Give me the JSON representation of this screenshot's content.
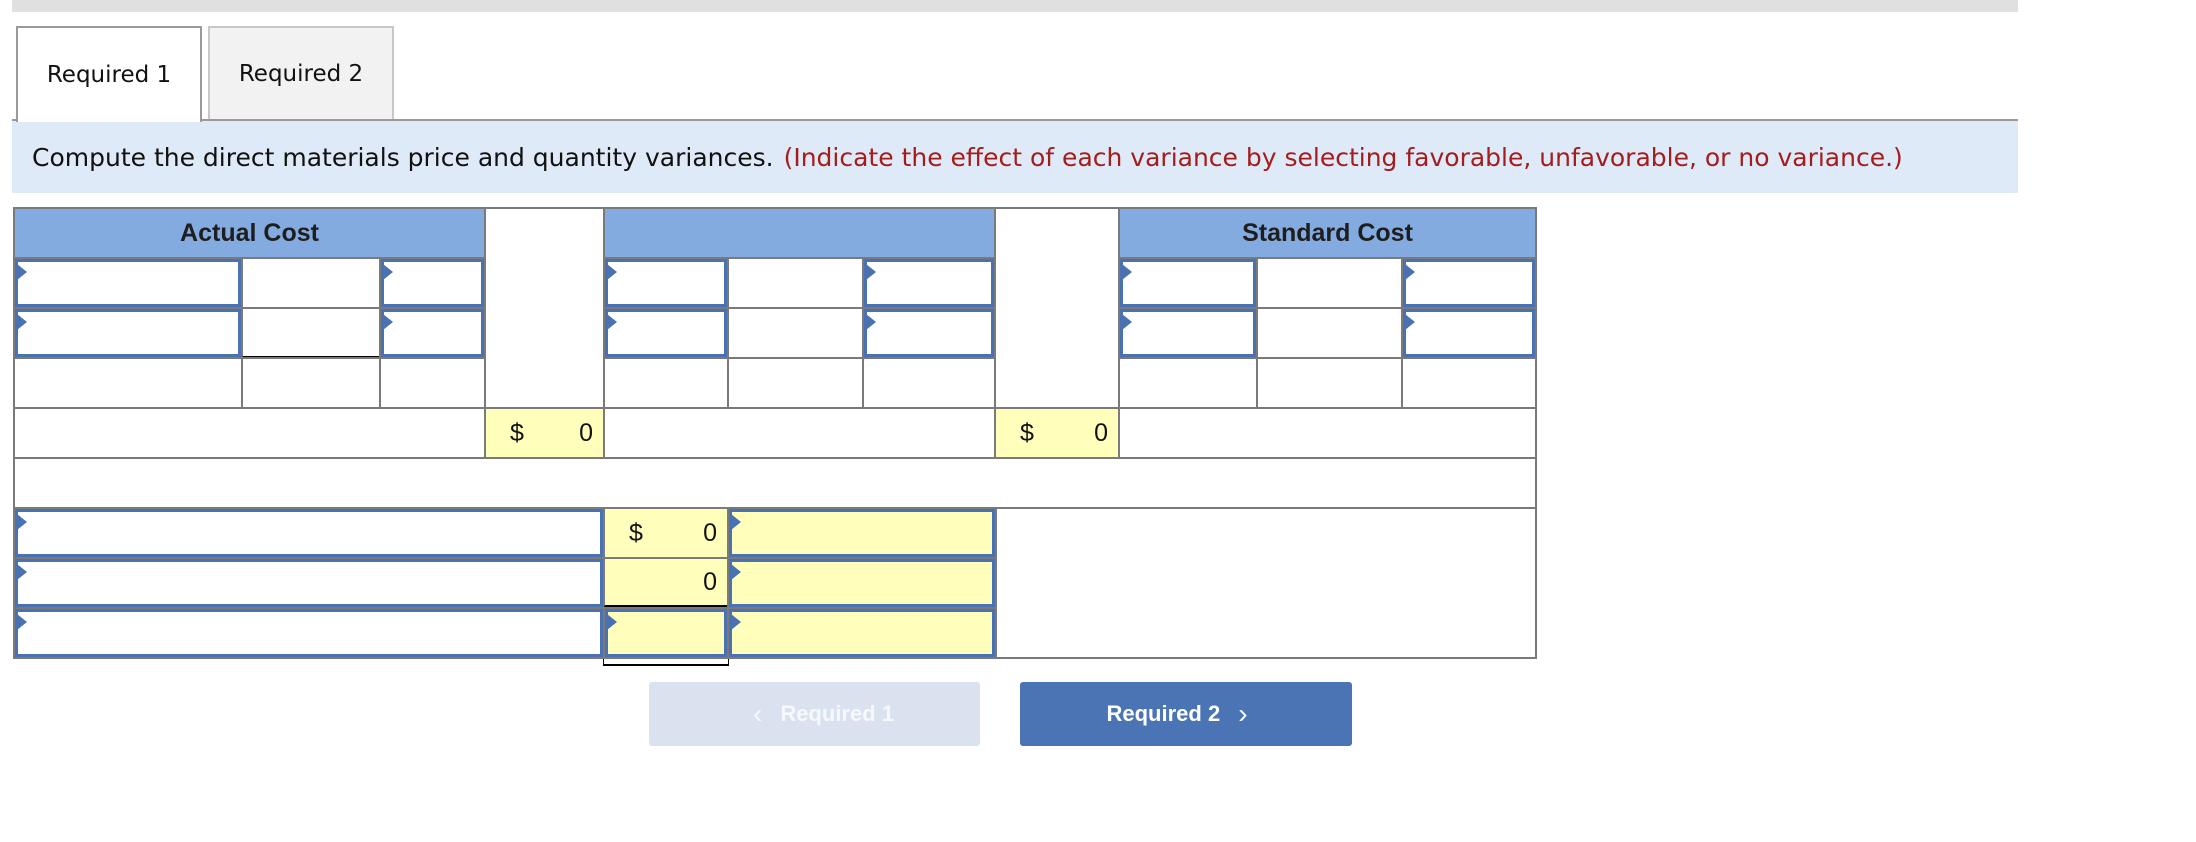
{
  "tabs": [
    {
      "label": "Required 1",
      "active": true
    },
    {
      "label": "Required 2",
      "active": false
    }
  ],
  "instruction": {
    "text": "Compute the direct materials price and quantity variances.",
    "note": "(Indicate the effect of each variance by selecting favorable, unfavorable, or no variance.)"
  },
  "table": {
    "headers": {
      "actual_cost": "Actual Cost",
      "middle": "",
      "standard_cost": "Standard Cost"
    },
    "totals": {
      "actual_total": {
        "currency": "$",
        "value": "0"
      },
      "middle_total": {
        "currency": "$",
        "value": "0"
      }
    },
    "variances": [
      {
        "label": "",
        "currency": "$",
        "value": "0",
        "effect": ""
      },
      {
        "label": "",
        "currency": "",
        "value": "0",
        "effect": ""
      },
      {
        "label": "",
        "currency": "",
        "value": "",
        "effect": ""
      }
    ]
  },
  "navigation": {
    "prev_label": "Required 1",
    "next_label": "Required 2",
    "prev_icon": "‹",
    "next_icon": "›"
  },
  "colors": {
    "header_blue": "#84abdf",
    "input_border": "#4a72b2",
    "total_yellow": "#ffffbb",
    "note_red": "#a51c1c",
    "band_blue": "#deeaf7",
    "next_button": "#4a74b4"
  }
}
